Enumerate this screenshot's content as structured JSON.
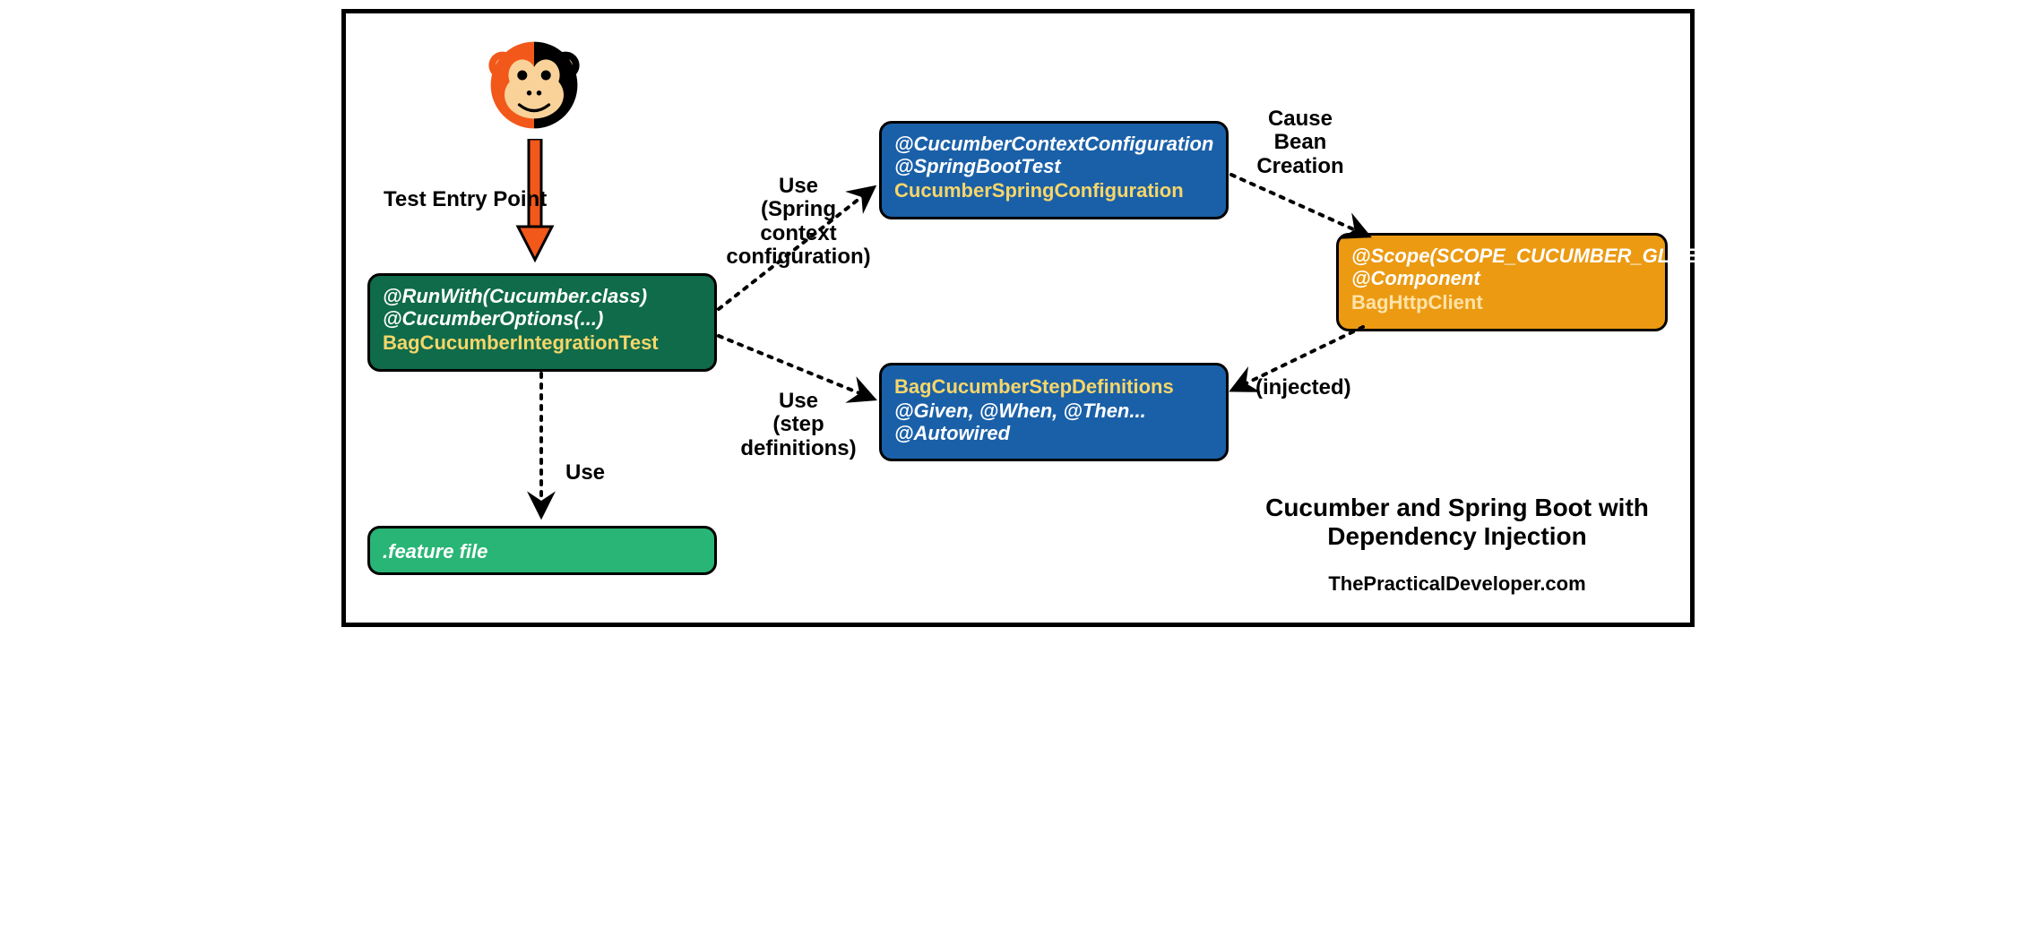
{
  "labels": {
    "entry": "Test Entry Point",
    "use_feature": "Use",
    "use_cfg_l1": "Use",
    "use_cfg_l2": "(Spring context",
    "use_cfg_l3": "configuration)",
    "use_step_l1": "Use",
    "use_step_l2": "(step",
    "use_step_l3": "definitions)",
    "cause_l1": "Cause",
    "cause_l2": "Bean",
    "cause_l3": "Creation",
    "injected": "(injected)"
  },
  "boxes": {
    "runner": {
      "a1": "@RunWith(Cucumber.class)",
      "a2": "@CucumberOptions(...)",
      "cls": "BagCucumberIntegrationTest"
    },
    "feature": {
      "cls": ".feature file"
    },
    "cfg": {
      "a1": "@CucumberContextConfiguration",
      "a2": "@SpringBootTest",
      "cls": "CucumberSpringConfiguration"
    },
    "steps": {
      "cls": "BagCucumberStepDefinitions",
      "a1": "@Given, @When, @Then...",
      "a2": "@Autowired"
    },
    "client": {
      "a1": "@Scope(SCOPE_CUCUMBER_GLUE)",
      "a2": "@Component",
      "cls": "BagHttpClient"
    }
  },
  "title": {
    "l1": "Cucumber and Spring Boot with",
    "l2": "Dependency Injection"
  },
  "credit": "ThePracticalDeveloper.com"
}
